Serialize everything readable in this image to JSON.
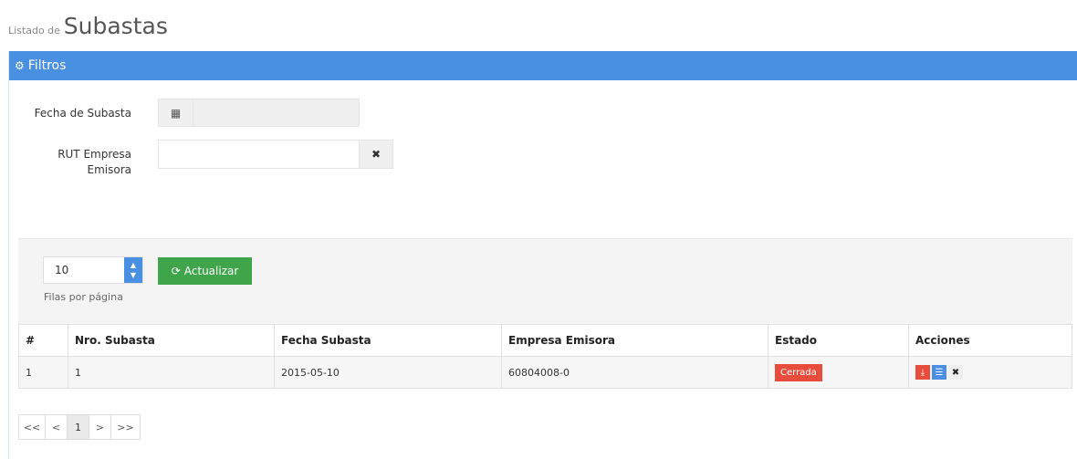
{
  "header": {
    "prefix": "Listado de",
    "title": "Subastas"
  },
  "filters": {
    "title": "Filtros",
    "fecha_label": "Fecha de Subasta",
    "fecha_value": "",
    "rut_label_line1": "RUT Empresa",
    "rut_label_line2": "Emisora",
    "rut_value": ""
  },
  "grid": {
    "rows_per_page": "10",
    "rows_label": "Filas por página",
    "refresh_label": "Actualizar",
    "columns": [
      "#",
      "Nro. Subasta",
      "Fecha Subasta",
      "Empresa Emisora",
      "Estado",
      "Acciones"
    ],
    "rows": [
      {
        "index": "1",
        "nro": "1",
        "fecha": "2015-05-10",
        "empresa": "60804008-0",
        "estado": "Cerrada"
      }
    ]
  },
  "pager": {
    "first": "<<",
    "prev": "<",
    "current": "1",
    "next": ">",
    "last": ">>"
  },
  "colors": {
    "primary": "#4a90e2",
    "success": "#3fa54a",
    "danger": "#e74c3c"
  },
  "icons": [
    "gears-icon",
    "calendar-icon",
    "clear-icon",
    "refresh-icon",
    "download-icon",
    "list-icon",
    "delete-icon"
  ]
}
